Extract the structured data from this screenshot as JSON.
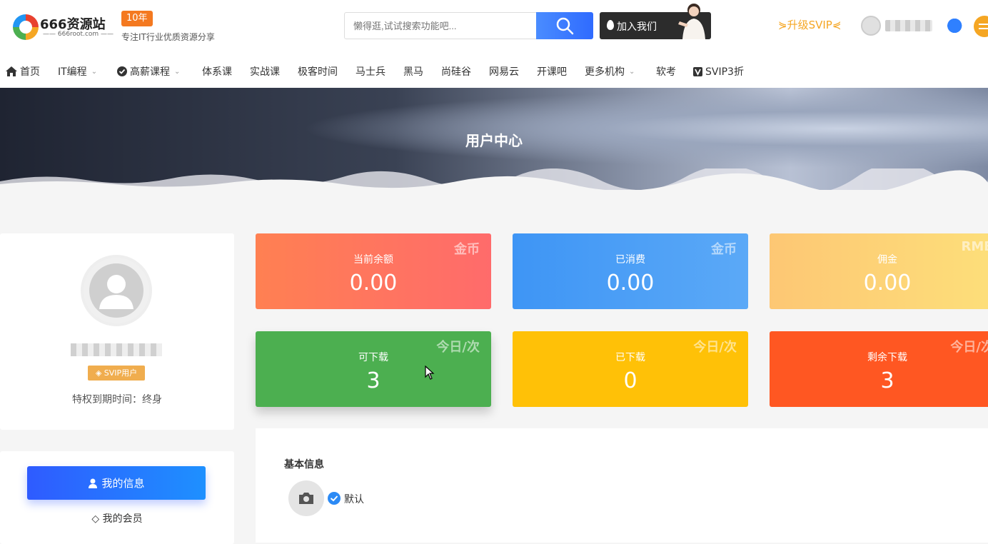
{
  "header": {
    "logo_text": "666资源站",
    "logo_sub": "—— 666root.com ——",
    "badge": "10年",
    "slogan": "专注IT行业优质资源分享",
    "search_placeholder": "懒得逛,试试搜索功能吧...",
    "join_label": "加入我们",
    "upgrade_label": "升级SVIP"
  },
  "nav": [
    {
      "label": "首页"
    },
    {
      "label": "IT编程"
    },
    {
      "label": "高薪课程"
    },
    {
      "label": "体系课"
    },
    {
      "label": "实战课"
    },
    {
      "label": "极客时间"
    },
    {
      "label": "马士兵"
    },
    {
      "label": "黑马"
    },
    {
      "label": "尚硅谷"
    },
    {
      "label": "网易云"
    },
    {
      "label": "开课吧"
    },
    {
      "label": "更多机构"
    },
    {
      "label": "软考"
    },
    {
      "label": "SVIP3折"
    }
  ],
  "banner": {
    "title": "用户中心"
  },
  "profile": {
    "vip_badge": "SVIP用户",
    "expire": "特权到期时间：终身"
  },
  "side_menu": {
    "my_info": "我的信息",
    "my_vip": "我的会员"
  },
  "stats": [
    {
      "label": "当前余额",
      "value": "0.00",
      "unit": "金币"
    },
    {
      "label": "已消费",
      "value": "0.00",
      "unit": "金币"
    },
    {
      "label": "佣金",
      "value": "0.00",
      "unit": "RMB"
    },
    {
      "label": "可下载",
      "value": "3",
      "unit": "今日/次"
    },
    {
      "label": "已下载",
      "value": "0",
      "unit": "今日/次"
    },
    {
      "label": "剩余下载",
      "value": "3",
      "unit": "今日/次"
    }
  ],
  "basic_info": {
    "title": "基本信息",
    "default_label": "默认"
  },
  "colors": {
    "accent": "#2f6bff",
    "balance": "#ff7560",
    "spent": "#4a9ef6",
    "commission": "#fdd077",
    "downloadable": "#4caf50",
    "downloaded": "#ffc107",
    "remaining": "#ff5722"
  }
}
